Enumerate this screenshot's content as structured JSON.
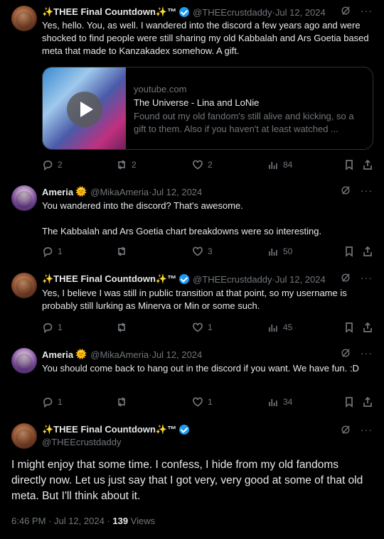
{
  "tweets": [
    {
      "name": "✨THEE Final Countdown✨™",
      "handle": "@THEEcrustdaddy",
      "date": "Jul 12, 2024",
      "body": [
        "Yes, hello. You, as well. I wandered into the discord a few years ago and were shocked to find people were still sharing my old Kabbalah and Ars Goetia based meta that made to Kanzakadex somehow. A gift."
      ],
      "card": {
        "domain": "youtube.com",
        "title": "The Universe - Lina and LoNie",
        "desc": "Found out my old fandom's still alive and kicking, so a gift to them. Also if you haven't at least watched ..."
      },
      "stats": {
        "replies": "2",
        "reposts": "2",
        "likes": "2",
        "views": "84"
      }
    },
    {
      "name": "Ameria",
      "handle": "@MikaAmeria",
      "date": "Jul 12, 2024",
      "body": [
        "You wandered into the discord? That's awesome.",
        "The Kabbalah and Ars Goetia chart breakdowns were so interesting."
      ],
      "stats": {
        "replies": "1",
        "reposts": "",
        "likes": "3",
        "views": "50"
      }
    },
    {
      "name": "✨THEE Final Countdown✨™",
      "handle": "@THEEcrustdaddy",
      "date": "Jul 12, 2024",
      "body": [
        "Yes, I believe I was still in public transition at that point, so my username is probably still lurking as Minerva or Min or some such."
      ],
      "stats": {
        "replies": "1",
        "reposts": "",
        "likes": "1",
        "views": "45"
      }
    },
    {
      "name": "Ameria",
      "handle": "@MikaAmeria",
      "date": "Jul 12, 2024",
      "body": [
        "You should come back to hang out in the discord if you want. We have fun. :D"
      ],
      "stats": {
        "replies": "1",
        "reposts": "",
        "likes": "1",
        "views": "34"
      }
    }
  ],
  "focus": {
    "name": "✨THEE Final Countdown✨™",
    "handle": "@THEEcrustdaddy",
    "body": "I might enjoy that some time. I confess, I hide from my old fandoms directly now. Let us just say that I got very, very good at some of that old meta. But I'll think about it.",
    "time": "6:46 PM · Jul 12, 2024 · ",
    "views_count": "139",
    "views_label": " Views"
  },
  "ui": {
    "separator": " · ",
    "sun": "🌞",
    "more": "···"
  },
  "colors": {
    "background": "#000000",
    "text": "#e7e9ea",
    "muted": "#71767b",
    "verified": "#1d9bf0",
    "border": "#2f3336"
  }
}
